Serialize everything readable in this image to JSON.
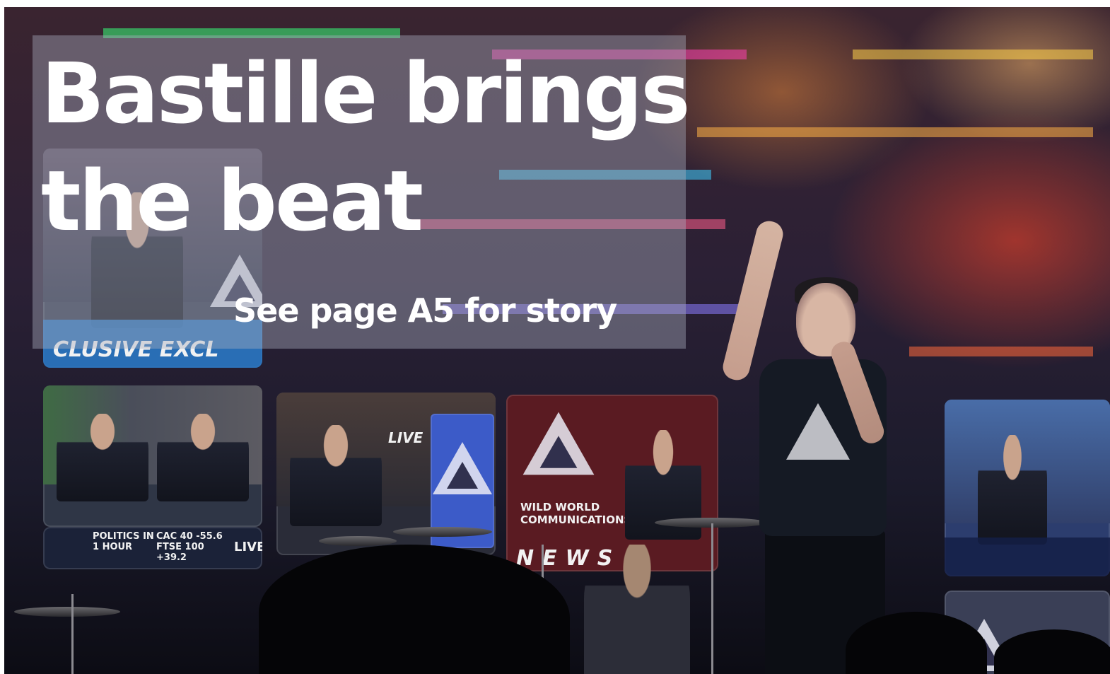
{
  "headline": {
    "line1": "Bastille brings",
    "line2": "the beat"
  },
  "subline": "See page A5 for story",
  "screens": {
    "live_1": "LIVE",
    "live_2": "LIVE",
    "ticker_politics": "POLITICS IN 1 HOUR",
    "ticker_markets": "CAC 40 -55.6  FTSE 100 +39.2",
    "brand": "WILD WORLD COMMUNICATIONS",
    "exclusive_banner": "CLUSIVE EXCL",
    "news": "NEWS"
  },
  "colors": {
    "overlay": "#aaafbe",
    "headline_text": "#ffffff",
    "stage_glow": "#ff4628"
  }
}
